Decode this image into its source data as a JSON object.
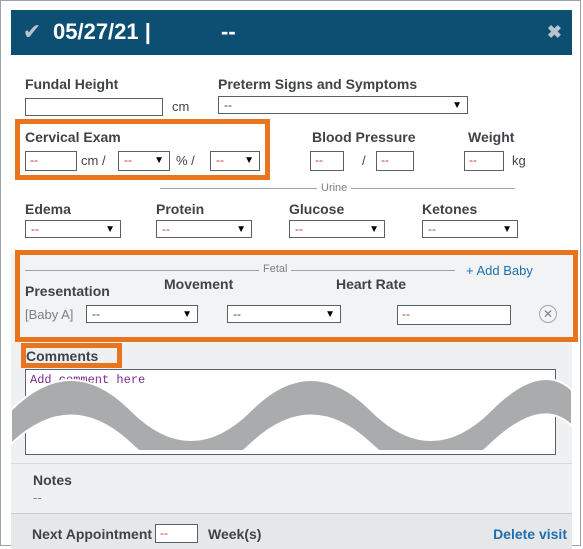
{
  "header": {
    "check_icon": "check-icon",
    "date": "05/27/21  |",
    "dash": "--",
    "close_icon": "close-icon"
  },
  "fundal_height": {
    "label": "Fundal Height",
    "value": "",
    "unit": "cm"
  },
  "preterm": {
    "label": "Preterm Signs and Symptoms",
    "value": "--"
  },
  "cervical_exam": {
    "label": "Cervical Exam",
    "cm_value": "--",
    "cm_unit": "cm /",
    "percent_value": "--",
    "percent_unit": "% /",
    "third_value": "--"
  },
  "blood_pressure": {
    "label": "Blood Pressure",
    "systolic": "--",
    "separator": "/",
    "diastolic": "--"
  },
  "weight": {
    "label": "Weight",
    "value": "--",
    "unit": "kg"
  },
  "urine": {
    "section_label": "Urine",
    "edema": {
      "label": "Edema",
      "value": "--"
    },
    "protein": {
      "label": "Protein",
      "value": "--"
    },
    "glucose": {
      "label": "Glucose",
      "value": "--"
    },
    "ketones": {
      "label": "Ketones",
      "value": "--"
    }
  },
  "fetal": {
    "section_label": "Fetal",
    "add_baby": "+ Add Baby",
    "presentation_label": "Presentation",
    "movement_label": "Movement",
    "heart_rate_label": "Heart Rate",
    "baby_label": "[Baby A]",
    "presentation_value": "--",
    "movement_value": "--",
    "heart_rate_value": "--",
    "remove_icon": "remove-circle-icon"
  },
  "comments": {
    "label": "Comments",
    "placeholder": "Add comment here"
  },
  "notes": {
    "label": "Notes",
    "value": "--"
  },
  "footer": {
    "next_appointment_label": "Next Appointment",
    "next_appointment_value": "--",
    "weeks_label": "Week(s)",
    "delete_link": "Delete visit"
  },
  "colors": {
    "header_bg": "#0d4f73",
    "highlight": "#e8741e",
    "link": "#1f6fae",
    "placeholder_red": "#c0392b"
  }
}
